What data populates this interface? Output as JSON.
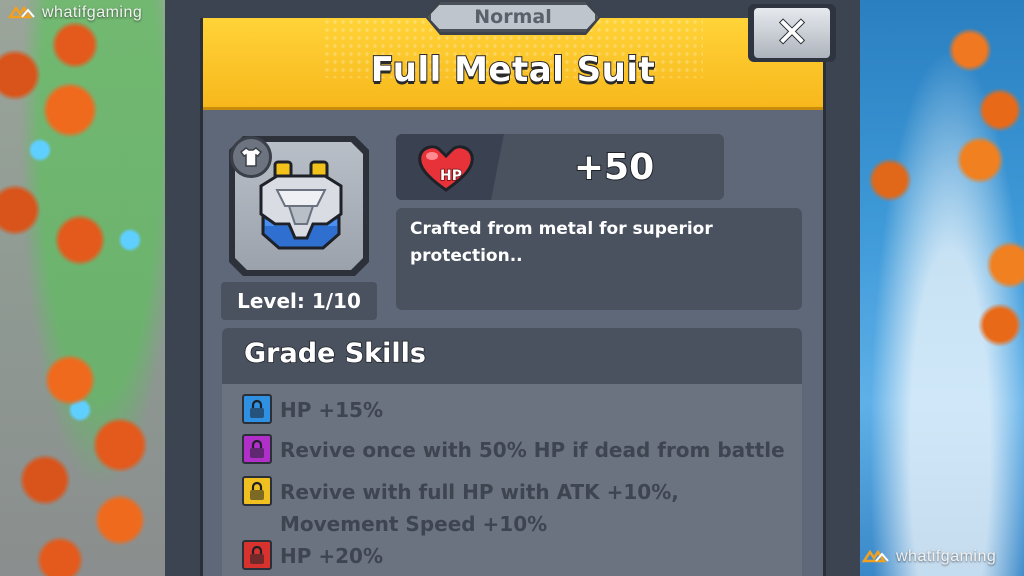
{
  "watermark": {
    "text": "whatifgaming"
  },
  "dialog": {
    "rarity": "Normal",
    "title": "Full Metal Suit",
    "close_label": "✕"
  },
  "item": {
    "slot_icon": "shirt-icon",
    "image_icon": "metal-armor-icon",
    "level": "Level: 1/10"
  },
  "stat": {
    "icon": "heart-icon",
    "icon_label": "HP",
    "value": "+50"
  },
  "description": "Crafted from metal for superior protection..",
  "grade_skills": {
    "title": "Grade Skills",
    "skills": [
      {
        "text": "HP +15%",
        "color": "#2f8fe0"
      },
      {
        "text": "Revive once with 50% HP if dead from battle",
        "color": "#b02fc8"
      },
      {
        "text": "Revive with full HP with ATK +10%,",
        "text2": "Movement Speed +10%",
        "color": "#f0c020"
      },
      {
        "text": "HP +20%",
        "color": "#d8322e"
      }
    ]
  },
  "colors": {
    "header": "#f7b81c",
    "panel": "#5f6878",
    "dark_box": "#4a5260"
  }
}
